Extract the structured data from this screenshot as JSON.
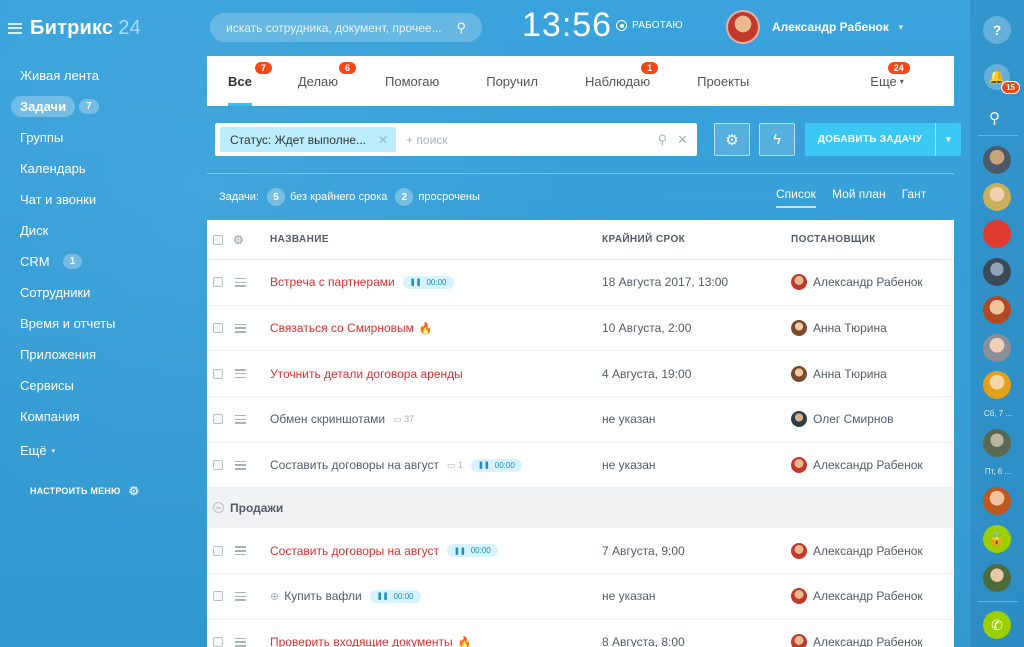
{
  "app": {
    "logo_main": "Битрикс",
    "logo_num": "24"
  },
  "left_menu": {
    "items": [
      {
        "label": "Живая лента",
        "count": ""
      },
      {
        "label": "Задачи",
        "count": "7"
      },
      {
        "label": "Группы",
        "count": ""
      },
      {
        "label": "Календарь",
        "count": ""
      },
      {
        "label": "Чат и звонки",
        "count": ""
      },
      {
        "label": "Диск",
        "count": ""
      },
      {
        "label": "CRM",
        "count": "1"
      },
      {
        "label": "Сотрудники",
        "count": ""
      },
      {
        "label": "Время и отчеты",
        "count": ""
      },
      {
        "label": "Приложения",
        "count": ""
      },
      {
        "label": "Сервисы",
        "count": ""
      },
      {
        "label": "Компания",
        "count": ""
      },
      {
        "label": "Ещё",
        "count": ""
      }
    ],
    "configure": "НАСТРОИТЬ МЕНЮ"
  },
  "header": {
    "search_placeholder": "искать сотрудника, документ, прочее...",
    "clock": "13:56",
    "work_status": "РАБОТАЮ",
    "user_name": "Александр Рабенок"
  },
  "tabs": [
    {
      "label": "Все",
      "badge": "7"
    },
    {
      "label": "Делаю",
      "badge": "6"
    },
    {
      "label": "Помогаю",
      "badge": ""
    },
    {
      "label": "Поручил",
      "badge": ""
    },
    {
      "label": "Наблюдаю",
      "badge": "1"
    },
    {
      "label": "Проекты",
      "badge": ""
    },
    {
      "label": "Еще",
      "badge": "24"
    }
  ],
  "filter": {
    "tag": "Статус: Ждет выполне...",
    "search_placeholder": "+ поиск"
  },
  "add_task": "ДОБАВИТЬ ЗАДАЧУ",
  "counters": {
    "prefix": "Задачи:",
    "no_deadline_count": "5",
    "no_deadline_label": "без крайнего срока",
    "overdue_count": "2",
    "overdue_label": "просрочены"
  },
  "views": [
    "Список",
    "Мой план",
    "Гант"
  ],
  "grid": {
    "headers": {
      "name": "НАЗВАНИЕ",
      "deadline": "КРАЙНИЙ СРОК",
      "owner": "ПОСТАНОВЩИК"
    },
    "rows": [
      {
        "name": "Встреча с партнерами",
        "deadline": "18 Августа 2017, 13:00",
        "owner": "Александр Рабенок",
        "timer": "00:00"
      },
      {
        "name": "Связаться со Смирновым",
        "deadline": "10 Августа, 2:00",
        "owner": "Анна Тюрина"
      },
      {
        "name": "Уточнить детали договора аренды",
        "deadline": "4 Августа, 19:00",
        "owner": "Анна Тюрина"
      },
      {
        "name": "Обмен скриншотами",
        "deadline": "не указан",
        "owner": "Олег Смирнов",
        "comments": "37"
      },
      {
        "name": "Составить договоры на август",
        "deadline": "не указан",
        "owner": "Александр Рабенок",
        "comments": "1",
        "timer": "00:00"
      }
    ],
    "group": "Продажи",
    "group_rows": [
      {
        "name": "Составить договоры на август",
        "deadline": "7 Августа, 9:00",
        "owner": "Александр Рабенок",
        "timer": "00:00"
      },
      {
        "name": "Купить вафли",
        "deadline": "не указан",
        "owner": "Александр Рабенок",
        "timer": "00:00"
      },
      {
        "name": "Проверить входящие документы",
        "deadline": "8 Августа, 8:00",
        "owner": "Александр Рабенок"
      }
    ]
  },
  "right_bar": {
    "notifications": "15",
    "label_1": "Сб, 7 ...",
    "label_2": "Пт, 6 ..."
  }
}
